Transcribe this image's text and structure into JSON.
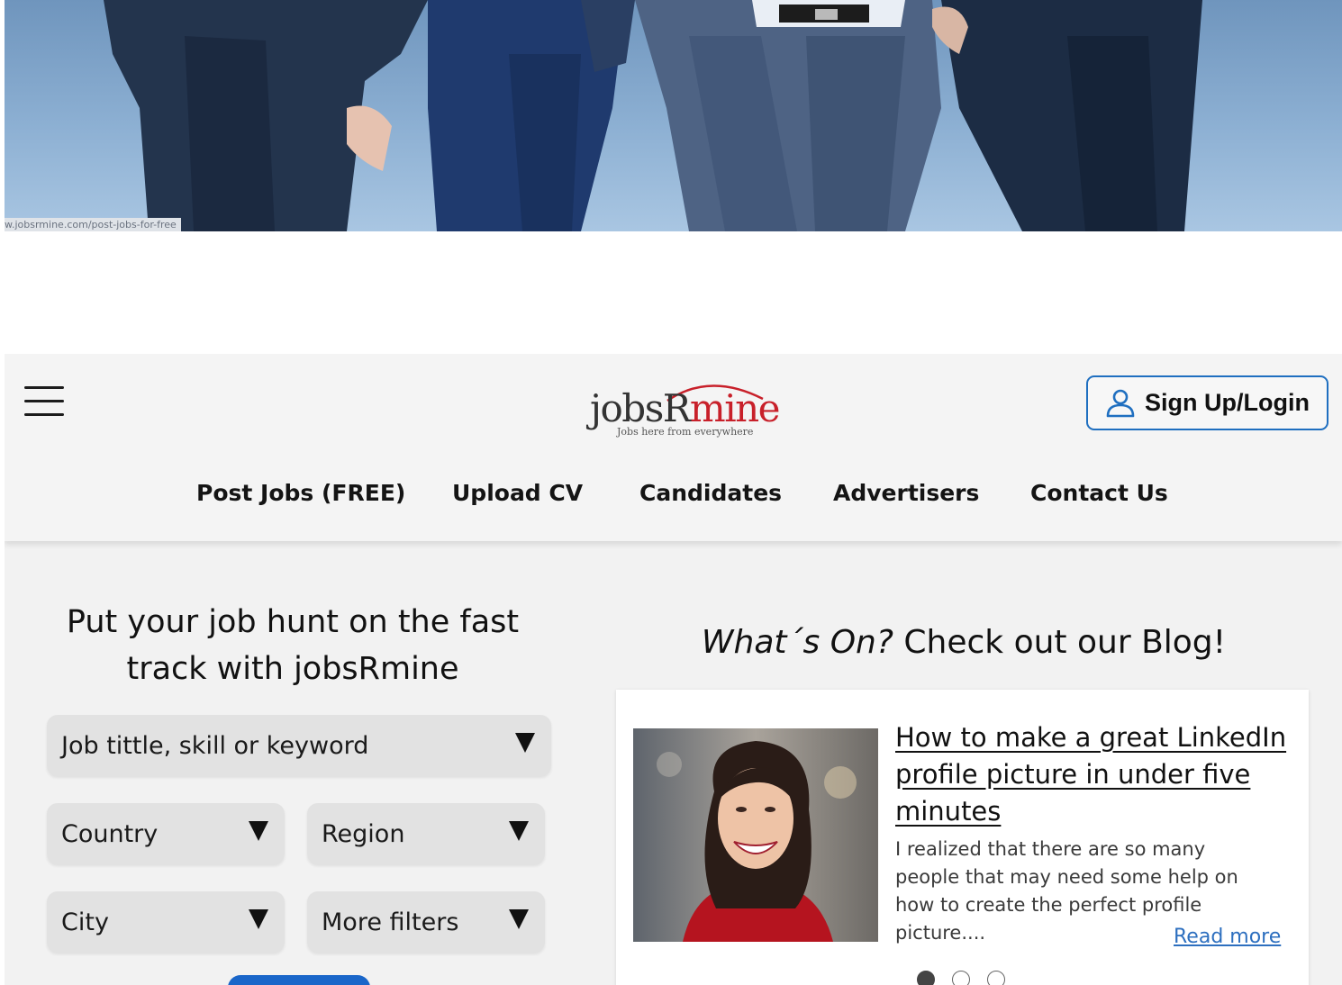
{
  "hero": {
    "url_snippet": "w.jobsrmine.com/post-jobs-for-free"
  },
  "header": {
    "logo": {
      "part1": "jobsR",
      "part2": "mine",
      "tagline": "Jobs here from everywhere"
    },
    "signin_label": "Sign Up/Login",
    "nav": [
      {
        "label": "Post Jobs (FREE)"
      },
      {
        "label": "Upload CV"
      },
      {
        "label": "Candidates"
      },
      {
        "label": "Advertisers"
      },
      {
        "label": "Contact Us"
      }
    ]
  },
  "search": {
    "headline_line1": "Put your job hunt on the fast",
    "headline_line2": "track with jobsRmine",
    "keyword": "Job tittle, skill or keyword",
    "country": "Country",
    "region": "Region",
    "city": "City",
    "more_filters": "More filters"
  },
  "blog": {
    "title_italic": "What´s On?",
    "title_rest": " Check out our Blog!",
    "heading": "How to make a great LinkedIn profile picture in under five minutes",
    "excerpt": "I realized that there are so many people that may need some help on how to create the perfect profile picture....",
    "read_more": "Read more",
    "active_dot": 1,
    "dot_count": 3
  },
  "colors": {
    "accent_blue": "#1f6fc0",
    "logo_red": "#c8202a",
    "link_blue": "#2d6fbf"
  }
}
